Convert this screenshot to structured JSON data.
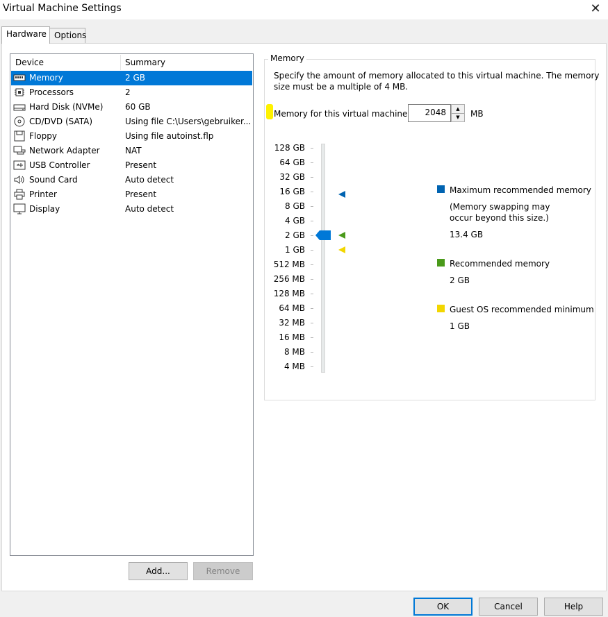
{
  "window": {
    "title": "Virtual Machine Settings"
  },
  "tabs": [
    {
      "label": "Hardware"
    },
    {
      "label": "Options"
    }
  ],
  "device_list": {
    "columns": [
      "Device",
      "Summary"
    ],
    "rows": [
      {
        "device": "Memory",
        "summary": "2 GB",
        "icon": "memory-icon",
        "selected": true
      },
      {
        "device": "Processors",
        "summary": "2",
        "icon": "processor-icon"
      },
      {
        "device": "Hard Disk (NVMe)",
        "summary": "60 GB",
        "icon": "hard-disk-icon"
      },
      {
        "device": "CD/DVD (SATA)",
        "summary": "Using file C:\\Users\\gebruiker...",
        "icon": "cd-dvd-icon"
      },
      {
        "device": "Floppy",
        "summary": "Using file autoinst.flp",
        "icon": "floppy-icon"
      },
      {
        "device": "Network Adapter",
        "summary": "NAT",
        "icon": "network-adapter-icon"
      },
      {
        "device": "USB Controller",
        "summary": "Present",
        "icon": "usb-icon"
      },
      {
        "device": "Sound Card",
        "summary": "Auto detect",
        "icon": "speaker-icon"
      },
      {
        "device": "Printer",
        "summary": "Present",
        "icon": "printer-icon"
      },
      {
        "device": "Display",
        "summary": "Auto detect",
        "icon": "display-icon"
      }
    ]
  },
  "buttons": {
    "add": "Add...",
    "remove": "Remove",
    "ok": "OK",
    "cancel": "Cancel",
    "help": "Help"
  },
  "memory": {
    "group_title": "Memory",
    "description_line1": "Specify the amount of memory allocated to this virtual machine. The memory",
    "description_line2": "size must be a multiple of 4 MB.",
    "field_label": "Memory for this virtual machine:",
    "value": "2048",
    "unit": "MB",
    "scale_labels": [
      "128 GB",
      "64 GB",
      "32 GB",
      "16 GB",
      "8 GB",
      "4 GB",
      "2 GB",
      "1 GB",
      "512 MB",
      "256 MB",
      "128 MB",
      "64 MB",
      "32 MB",
      "16 MB",
      "8 MB",
      "4 MB"
    ],
    "slider_level": "2 GB",
    "markers": {
      "maximum": "16 GB",
      "recommended": "2 GB",
      "minimum": "1 GB"
    },
    "legend": {
      "max_title": "Maximum recommended memory",
      "max_note_line1": "(Memory swapping may",
      "max_note_line2": "occur beyond this size.)",
      "max_value": "13.4 GB",
      "rec_title": "Recommended memory",
      "rec_value": "2 GB",
      "min_title": "Guest OS recommended minimum",
      "min_value": "1 GB"
    },
    "colors": {
      "maximum": "#0063b1",
      "recommended": "#4a9a1a",
      "minimum": "#f2d600",
      "selection": "#0078d7",
      "highlight": "#fff200"
    }
  }
}
